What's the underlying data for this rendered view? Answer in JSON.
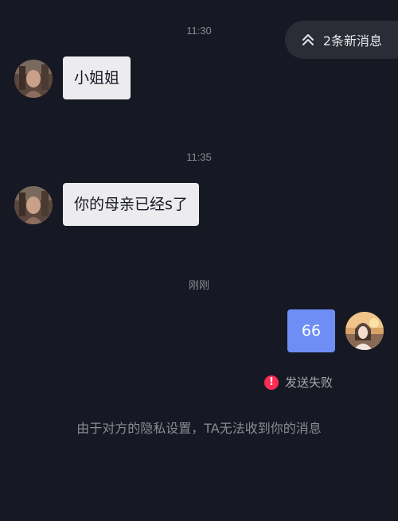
{
  "new_messages_pill": {
    "label": "2条新消息",
    "icon": "double-chevron-up-icon"
  },
  "messages": [
    {
      "timestamp": "11:30",
      "sender": "other",
      "text": "小姐姐"
    },
    {
      "timestamp": "11:35",
      "sender": "other",
      "text": "你的母亲已经s了"
    },
    {
      "timestamp": "刚刚",
      "sender": "self",
      "text": "66",
      "status": "发送失败",
      "status_icon": "alert-icon"
    }
  ],
  "system_note": "由于对方的隐私设置，TA无法收到你的消息",
  "colors": {
    "background": "#161823",
    "incoming_bubble": "#ececef",
    "outgoing_bubble": "#6e8ef5",
    "error": "#fe2c55"
  }
}
